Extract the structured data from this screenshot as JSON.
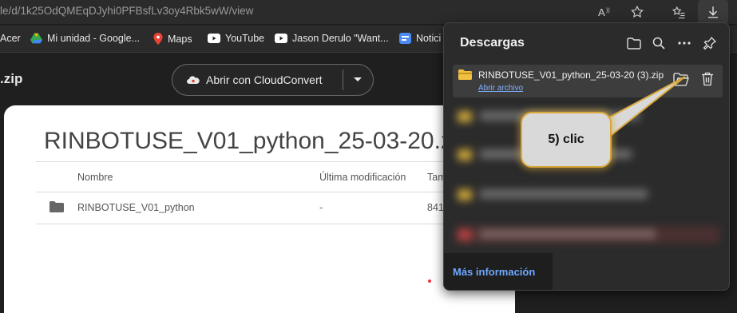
{
  "address_bar": {
    "url": "le/d/1k25OdQMEqDJyhi0PFBsfLv3oy4Rbk5wW/view"
  },
  "bookmarks": [
    {
      "label": "Acer",
      "icon": "bookmark-icon",
      "color": "#2b2b2b"
    },
    {
      "label": "Mi unidad - Google...",
      "icon": "google-drive-icon",
      "color": "#34a853"
    },
    {
      "label": "Maps",
      "icon": "maps-pin-icon",
      "color": "#ea4335"
    },
    {
      "label": "YouTube",
      "icon": "youtube-icon",
      "color": "#ffffff"
    },
    {
      "label": "Jason Derulo \"Want...",
      "icon": "youtube-icon",
      "color": "#ffffff"
    },
    {
      "label": "Notici",
      "icon": "news-icon",
      "color": "#4c8bf5"
    }
  ],
  "page_header": {
    "file_label": ".zip",
    "open_with_label": "Abrir con CloudConvert"
  },
  "card": {
    "title": "RINBOTUSE_V01_python_25-03-20.z",
    "columns": [
      "Nombre",
      "Última modificación",
      "Tam"
    ],
    "rows": [
      {
        "name": "RINBOTUSE_V01_python",
        "modified": "-",
        "size": "841"
      }
    ]
  },
  "downloads_panel": {
    "title": "Descargas",
    "item": {
      "filename": "RINBOTUSE_V01_python_25-03-20 (3).zip",
      "open_link": "Abrir archivo"
    },
    "more_info": "Más información"
  },
  "callout": {
    "text": "5) clic"
  },
  "colors": {
    "link": "#7fb0ff",
    "more_info": "#6ea8ff",
    "callout_border": "#d8a73a",
    "folder": "#f0c040"
  }
}
